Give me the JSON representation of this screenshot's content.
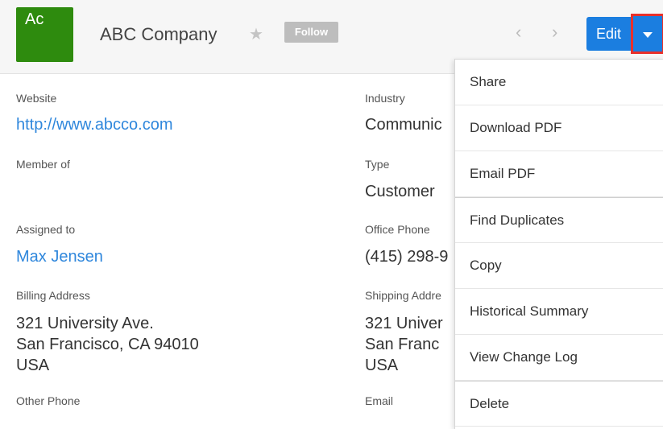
{
  "header": {
    "avatar_text": "Ac",
    "title": "ABC Company",
    "follow_label": "Follow",
    "prev_arrow": "‹",
    "next_arrow": "›",
    "edit_label": "Edit"
  },
  "fields": {
    "website_label": "Website",
    "website_value": "http://www.abcco.com",
    "industry_label": "Industry",
    "industry_value": "Communic",
    "member_of_label": "Member of",
    "type_label": "Type",
    "type_value": "Customer",
    "assigned_to_label": "Assigned to",
    "assigned_to_value": "Max Jensen",
    "office_phone_label": "Office Phone",
    "office_phone_value": "(415) 298-9",
    "billing_label": "Billing Address",
    "billing_line1": "321 University Ave.",
    "billing_line2": "San Francisco, CA 94010",
    "billing_line3": "USA",
    "shipping_label": "Shipping Addre",
    "shipping_line1": "321 Univer",
    "shipping_line2": "San Franc",
    "shipping_line3": "USA",
    "other_phone_label": "Other Phone",
    "email_label": "Email"
  },
  "menu": {
    "items": [
      "Share",
      "Download PDF",
      "Email PDF",
      "Find Duplicates",
      "Copy",
      "Historical Summary",
      "View Change Log",
      "Delete"
    ]
  },
  "colors": {
    "avatar": "#2e8b0e",
    "primary": "#1b7ee0",
    "highlight": "#e8302a",
    "link": "#2f87dc"
  }
}
